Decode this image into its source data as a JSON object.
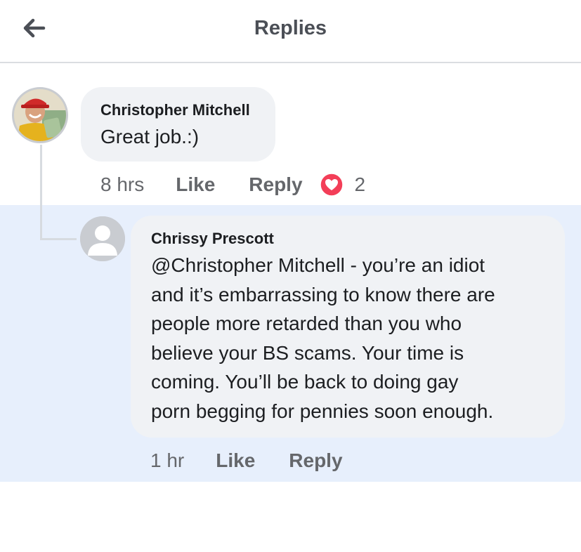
{
  "header": {
    "title": "Replies"
  },
  "comment": {
    "author": "Christopher Mitchell",
    "text": "Great job.:)",
    "time": "8 hrs",
    "like_label": "Like",
    "reply_label": "Reply",
    "reaction": {
      "icon": "love-reaction-icon",
      "count": "2",
      "color": "#f33e58"
    }
  },
  "reply": {
    "author": "Chrissy Prescott",
    "text_lines": [
      "@Christopher Mitchell - you’re an idiot",
      "and it’s embarrassing to know there are",
      "people more retarded than you who",
      "believe your BS scams.  Your time is",
      "coming.  You’ll be back to doing gay",
      "porn begging for pennies soon enough."
    ],
    "time": "1 hr",
    "like_label": "Like",
    "reply_label": "Reply"
  },
  "colors": {
    "reply_highlight": "#e7effc",
    "bubble": "#f0f2f5",
    "meta_text": "#65676b"
  }
}
